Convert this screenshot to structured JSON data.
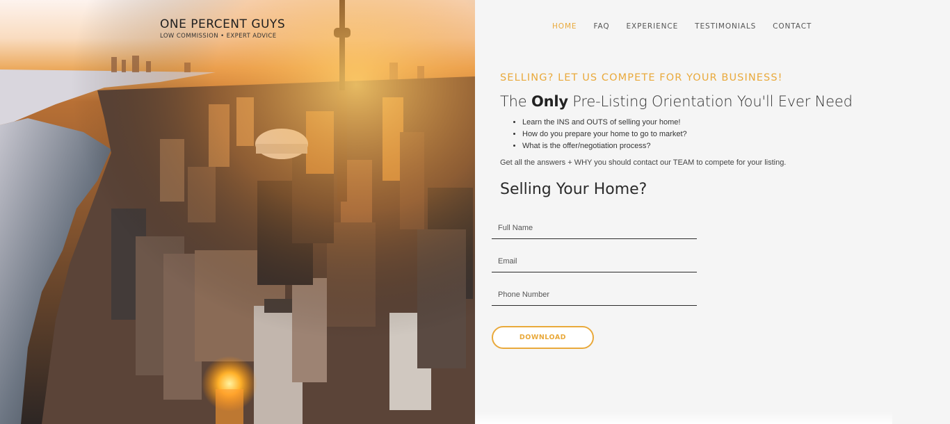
{
  "brand": {
    "name": "ONE PERCENT GUYS",
    "tagline": "LOW COMMISSION • EXPERT ADVICE"
  },
  "nav": {
    "items": [
      {
        "label": "HOME",
        "active": true
      },
      {
        "label": "FAQ",
        "active": false
      },
      {
        "label": "EXPERIENCE",
        "active": false
      },
      {
        "label": "TESTIMONIALS",
        "active": false
      },
      {
        "label": "CONTACT",
        "active": false
      }
    ]
  },
  "hero_image": {
    "subject": "aerial-city-skyline-sunset"
  },
  "main": {
    "eyebrow": "SELLING? LET US COMPETE FOR YOUR BUSINESS!",
    "headline_pre": "The ",
    "headline_bold": "Only",
    "headline_post": " Pre-Listing Orientation You'll Ever Need",
    "bullets": [
      "Learn the INS and OUTS of selling your home!",
      "How do you prepare your home to go to market?",
      "What is the offer/negotiation process?"
    ],
    "cta_text": "Get all the answers + WHY you should contact our TEAM to compete for your listing."
  },
  "form": {
    "title": "Selling Your Home?",
    "full_name": {
      "placeholder": "Full Name",
      "value": ""
    },
    "email": {
      "placeholder": "Email",
      "value": ""
    },
    "phone": {
      "placeholder": "Phone Number",
      "value": ""
    },
    "submit_label": "DOWNLOAD"
  },
  "colors": {
    "accent": "#e9a93b",
    "text": "#333333",
    "background": "#f5f5f5"
  }
}
